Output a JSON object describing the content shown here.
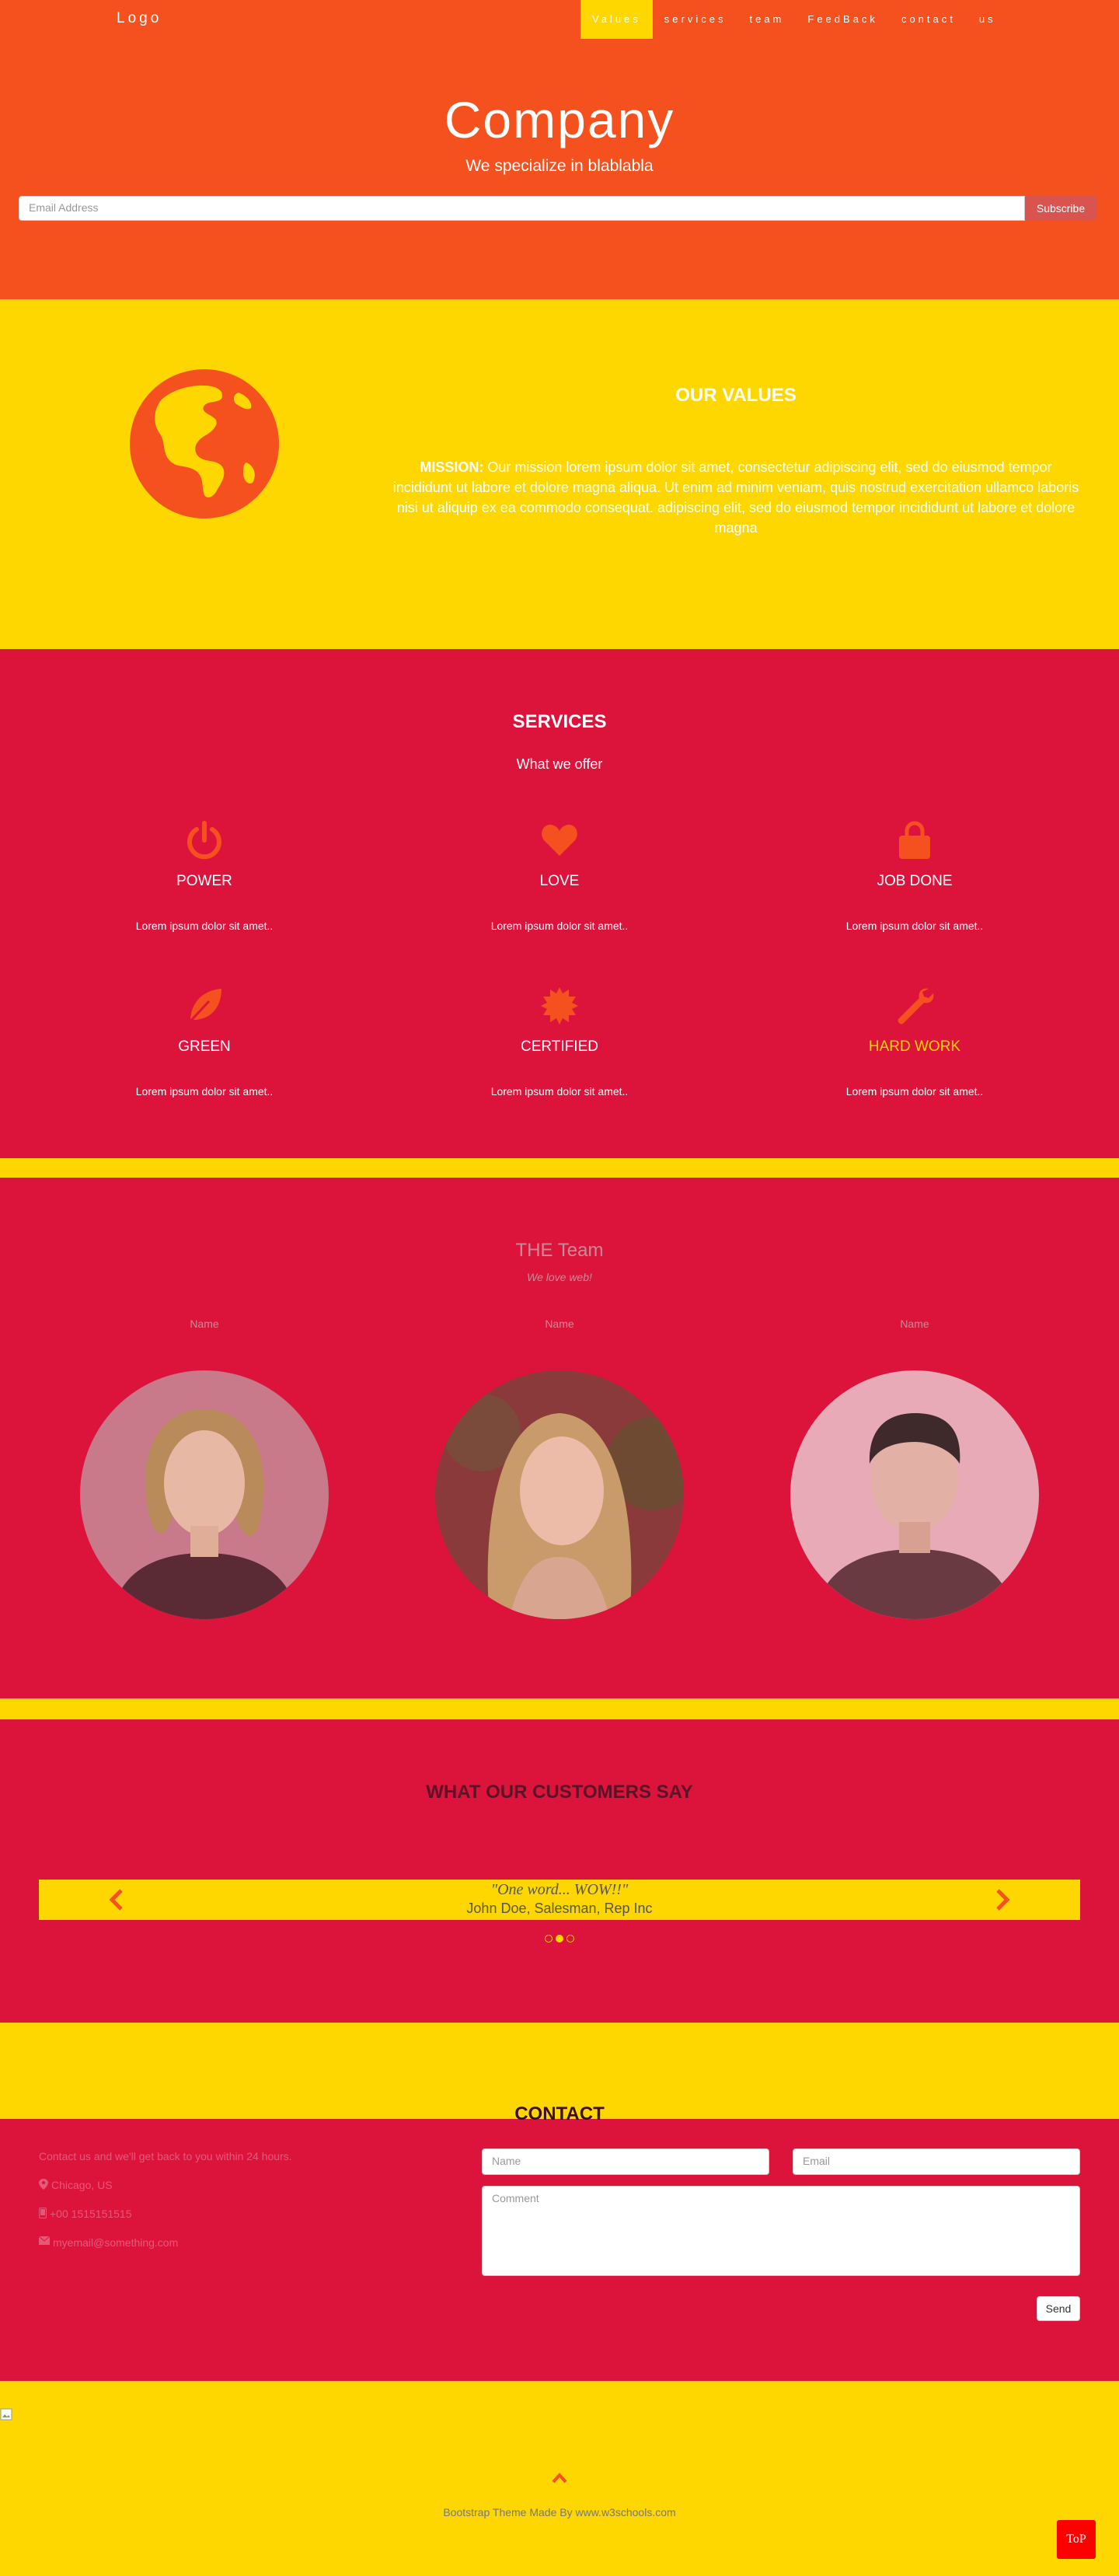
{
  "nav": {
    "logo": "Logo",
    "items": [
      "Values",
      "services",
      "team",
      "FeedBack",
      "contact",
      "us"
    ]
  },
  "hero": {
    "title": "Company",
    "subtitle": "We specialize in blablabla",
    "email_placeholder": "Email Address",
    "subscribe_label": "Subscribe"
  },
  "values": {
    "heading": "OUR VALUES",
    "mission_label": "MISSION:",
    "mission_text": " Our mission lorem ipsum dolor sit amet, consectetur adipiscing elit, sed do eiusmod tempor incididunt ut labore et dolore magna aliqua. Ut enim ad minim veniam, quis nostrud exercitation ullamco laboris nisi ut aliquip ex ea commodo consequat. adipiscing elit, sed do eiusmod tempor incididunt ut labore et dolore magna",
    "icon": "globe-icon"
  },
  "services": {
    "heading": "SERVICES",
    "subheading": "What we offer",
    "items": [
      {
        "title": "POWER",
        "text": "Lorem ipsum dolor sit amet..",
        "icon": "power-icon"
      },
      {
        "title": "LOVE",
        "text": "Lorem ipsum dolor sit amet..",
        "icon": "heart-icon"
      },
      {
        "title": "JOB DONE",
        "text": "Lorem ipsum dolor sit amet..",
        "icon": "lock-icon"
      },
      {
        "title": "GREEN",
        "text": "Lorem ipsum dolor sit amet..",
        "icon": "leaf-icon"
      },
      {
        "title": "CERTIFIED",
        "text": "Lorem ipsum dolor sit amet..",
        "icon": "certificate-icon"
      },
      {
        "title": "HARD WORK",
        "text": "Lorem ipsum dolor sit amet..",
        "icon": "wrench-icon"
      }
    ]
  },
  "team": {
    "heading": "THE Team",
    "subheading": "We love web!",
    "members": [
      {
        "name": "Name"
      },
      {
        "name": "Name"
      },
      {
        "name": "Name"
      }
    ]
  },
  "testimonials": {
    "heading": "WHAT OUR CUSTOMERS SAY",
    "quote": "\"One word... WOW!!\"",
    "author": "John Doe, Salesman, Rep Inc"
  },
  "contact": {
    "heading": "CONTACT",
    "intro": "Contact us and we'll get back to you within 24 hours.",
    "location": "Chicago, US",
    "phone": "+00 1515151515",
    "email": "myemail@something.com",
    "name_placeholder": "Name",
    "email_placeholder": "Email",
    "comment_placeholder": "Comment",
    "send_label": "Send"
  },
  "footer": {
    "credit_prefix": "Bootstrap Theme Made By ",
    "credit_link": "www.w3schools.com",
    "top_label": "ToP"
  },
  "colors": {
    "orange": "#f4511e",
    "gold": "#ffd700",
    "crimson": "#dc143c"
  }
}
